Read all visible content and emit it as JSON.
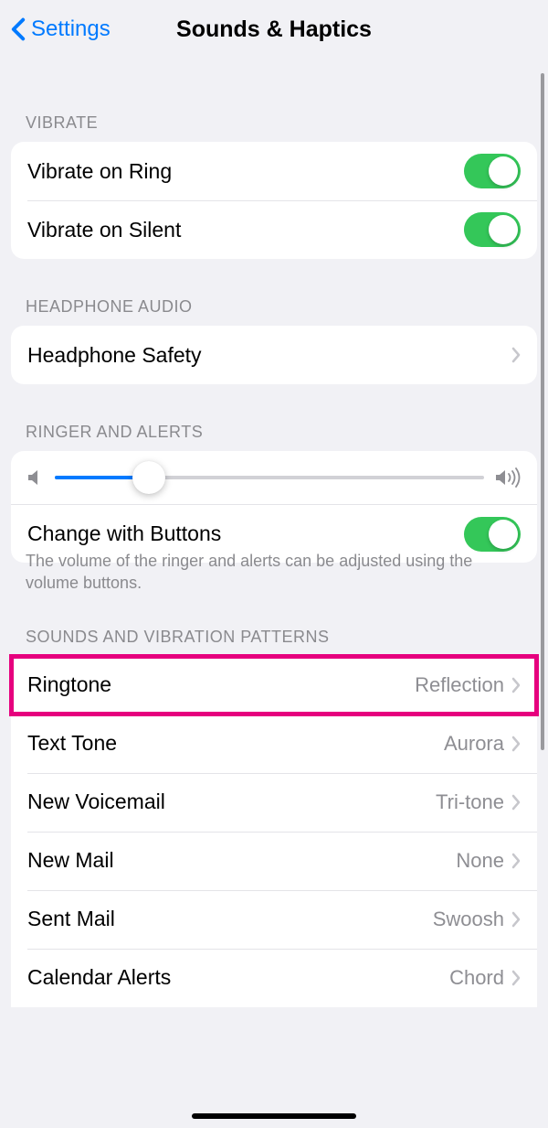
{
  "header": {
    "back_label": "Settings",
    "title": "Sounds & Haptics"
  },
  "sections": {
    "vibrate": {
      "header": "VIBRATE",
      "items": {
        "ring": {
          "label": "Vibrate on Ring",
          "on": true
        },
        "silent": {
          "label": "Vibrate on Silent",
          "on": true
        }
      }
    },
    "headphone": {
      "header": "HEADPHONE AUDIO",
      "items": {
        "safety": {
          "label": "Headphone Safety"
        }
      }
    },
    "ringer": {
      "header": "RINGER AND ALERTS",
      "slider_value_percent": 22,
      "change_buttons": {
        "label": "Change with Buttons",
        "on": true
      },
      "footer": "The volume of the ringer and alerts can be adjusted using the volume buttons."
    },
    "sounds": {
      "header": "SOUNDS AND VIBRATION PATTERNS",
      "items": [
        {
          "label": "Ringtone",
          "value": "Reflection",
          "highlight": true
        },
        {
          "label": "Text Tone",
          "value": "Aurora"
        },
        {
          "label": "New Voicemail",
          "value": "Tri-tone"
        },
        {
          "label": "New Mail",
          "value": "None"
        },
        {
          "label": "Sent Mail",
          "value": "Swoosh"
        },
        {
          "label": "Calendar Alerts",
          "value": "Chord"
        }
      ]
    }
  }
}
